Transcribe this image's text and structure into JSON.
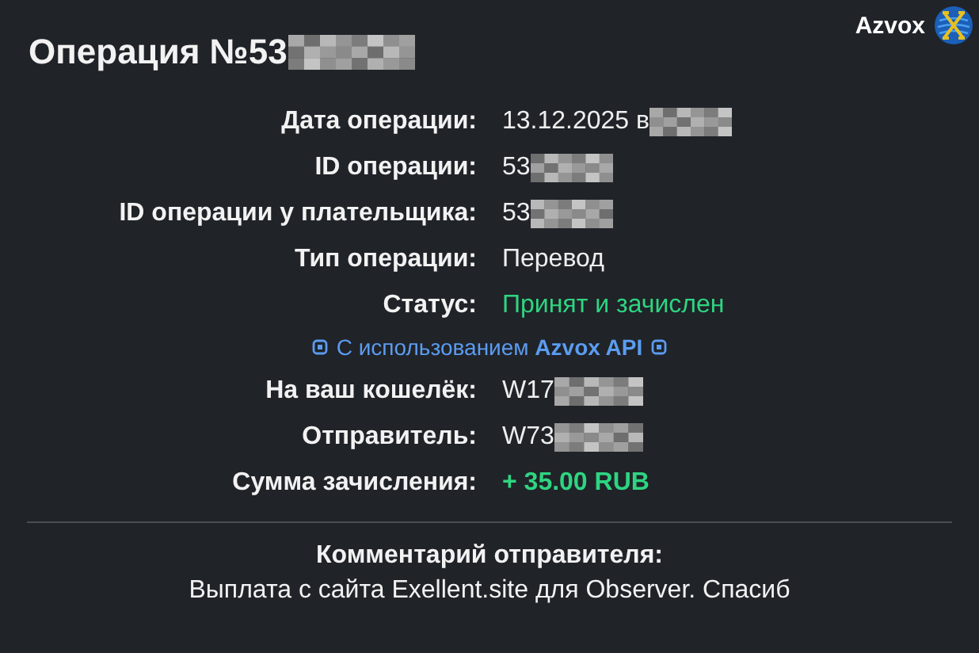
{
  "brand": {
    "name": "Azvox"
  },
  "title": {
    "text": "Операция №53",
    "redacted": true
  },
  "details": [
    {
      "label": "Дата операции:",
      "value": "13.12.2025 в",
      "kind": "text",
      "redacted": true
    },
    {
      "label": "ID операции:",
      "value": "53",
      "kind": "text",
      "redacted": true
    },
    {
      "label": "ID операции у плательщика:",
      "value": "53",
      "kind": "text",
      "redacted": true
    },
    {
      "label": "Тип операции:",
      "value": "Перевод",
      "kind": "text"
    },
    {
      "label": "Статус:",
      "value": "Принят и зачислен",
      "kind": "status"
    }
  ],
  "api_note": "С использованием **Azvox API**",
  "transfer": [
    {
      "label": "На ваш кошелёк:",
      "value": "W17",
      "kind": "text",
      "redacted": true
    },
    {
      "label": "Отправитель:",
      "value": "W73",
      "kind": "text",
      "redacted": true
    },
    {
      "label": "Сумма зачисления:",
      "value": "+ 35.00 RUB",
      "kind": "amount"
    }
  ],
  "comment": {
    "title": "Комментарий отправителя:",
    "text": "Выплата с сайта Exellent.site для Observer. Спасиб"
  }
}
